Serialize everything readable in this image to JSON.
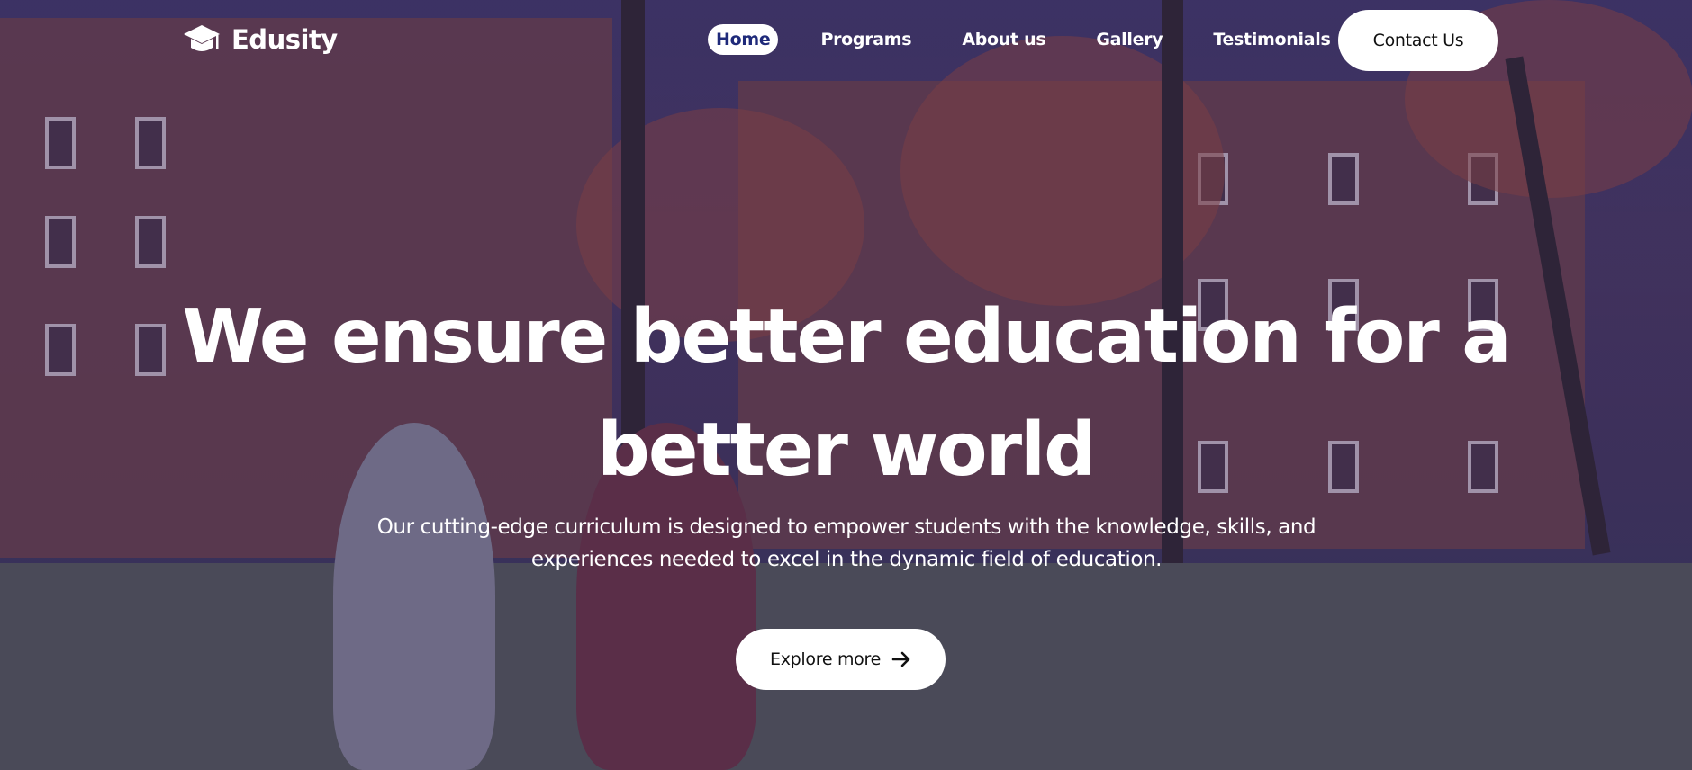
{
  "brand": {
    "name": "Edusity",
    "icon": "graduation-cap-icon"
  },
  "nav": {
    "items": [
      {
        "label": "Home",
        "active": true
      },
      {
        "label": "Programs",
        "active": false
      },
      {
        "label": "About us",
        "active": false
      },
      {
        "label": "Gallery",
        "active": false
      },
      {
        "label": "Testimonials",
        "active": false
      }
    ],
    "contact_label": "Contact Us"
  },
  "hero": {
    "headline_line1": "We ensure better education for a",
    "headline_line2": "better world",
    "subtitle_line1": "Our cutting-edge curriculum is designed to empower students with the knowledge, skills, and",
    "subtitle_line2": "experiences needed to excel in the dynamic field of education.",
    "cta_label": "Explore more",
    "cta_icon": "arrow-right-icon"
  },
  "colors": {
    "overlay": "#30285c",
    "active_nav_text": "#1f2a7a",
    "button_bg": "#ffffff"
  }
}
